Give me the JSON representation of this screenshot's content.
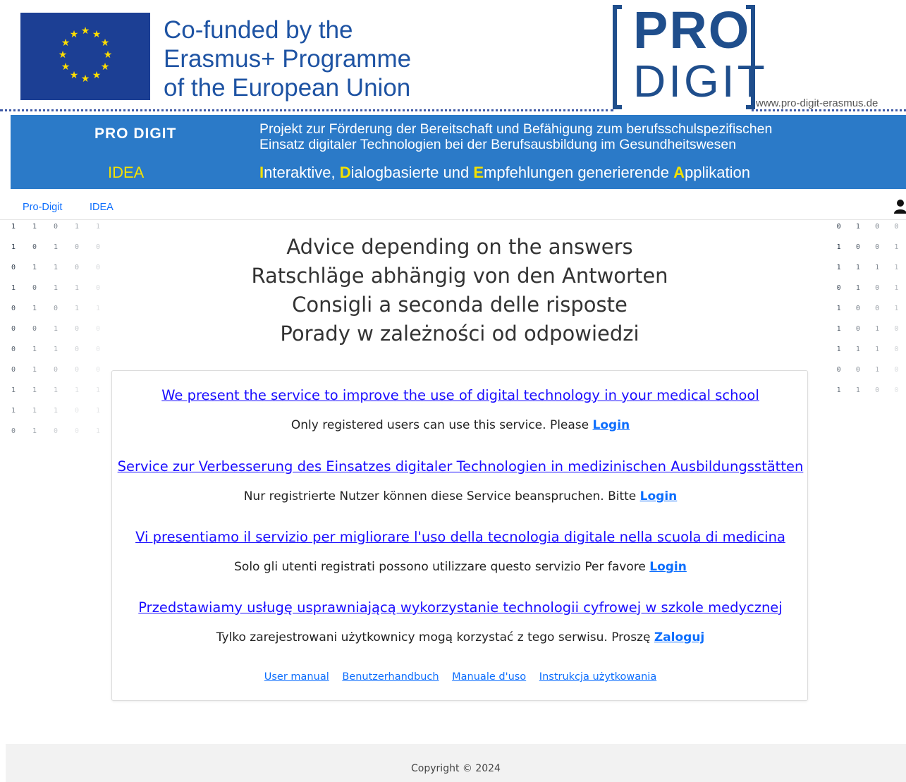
{
  "banner": {
    "eu_lines": [
      "Co-funded by the",
      "Erasmus+ Programme",
      "of the European Union"
    ],
    "logo_top": "PRO",
    "logo_bottom": "DIGIT",
    "site_url": "www.pro-digit-erasmus.de",
    "pro_digit_label": "PRO  DIGIT",
    "idea_label": "IDEA",
    "description_lines": [
      "Projekt zur Förderung der Bereitschaft und Befähigung zum berufsschulspezifischen",
      "Einsatz digitaler Technologien bei der Berufsausbildung im Gesundheitswesen"
    ],
    "acronym": {
      "I": "I",
      "i_rest": "nteraktive, ",
      "D": "D",
      "d_rest": "ialogbasierte und ",
      "E": "E",
      "e_rest": "mpfehlungen generierende ",
      "A": "A",
      "a_rest": "pplikation"
    },
    "colors": {
      "eu_blue": "#1c3f94",
      "band_blue": "#2b7ac8",
      "highlight_yellow": "#f4e100"
    }
  },
  "nav": {
    "items": [
      {
        "label": "Pro-Digit"
      },
      {
        "label": "IDEA"
      }
    ],
    "user_icon": "user-icon"
  },
  "heading": {
    "lines": [
      "Advice depending on the answers",
      "Ratschläge abhängig von den Antworten",
      "Consigli a seconda delle risposte",
      "Porady w zależności od odpowiedzi"
    ]
  },
  "services": [
    {
      "title": "We present the service to improve the use of digital technology in your medical school",
      "info": "Only registered users can use this service.  Please ",
      "login": "Login"
    },
    {
      "title": "Service zur Verbesserung des Einsatzes digitaler Technologien in medizinischen Ausbildungsstätten",
      "info": "Nur registrierte Nutzer können diese Service beanspruchen.  Bitte ",
      "login": "Login"
    },
    {
      "title": "Vi presentiamo il servizio per migliorare l'uso della tecnologia digitale nella scuola di medicina",
      "info": "Solo gli utenti registrati possono utilizzare questo servizio  Per favore ",
      "login": "Login"
    },
    {
      "title": "Przedstawiamy usługę usprawniającą wykorzystanie technologii cyfrowej w szkole medycznej",
      "info": "Tylko zarejestrowani użytkownicy mogą korzystać z tego serwisu.  Proszę ",
      "login": "Zaloguj"
    }
  ],
  "manuals": [
    "User manual",
    "Benutzerhandbuch",
    "Manuale d'uso",
    "Instrukcja użytkowania"
  ],
  "footer": {
    "copyright": "Copyright © 2024"
  },
  "binary_left": [
    "1 1 0 1 1",
    "1 0 1 0 0",
    "0 1 1 0 0",
    "1 0 1 1 0",
    "0 1 0 1 1",
    "0 0 1 0 0",
    "0 1 1 0 0",
    "0 1 0 0 0",
    "1 1 1 1 1",
    "1 1 1 0 1",
    "0 1 0 0 1"
  ],
  "binary_right": [
    "0 1 0 0",
    "1 0 0 1",
    "1 1 1 1",
    "0 1 0 1",
    "1 0 0 1",
    "1 0 1 0",
    "1 1 1 0",
    "0 0 1 0",
    "1 1 0 0"
  ]
}
